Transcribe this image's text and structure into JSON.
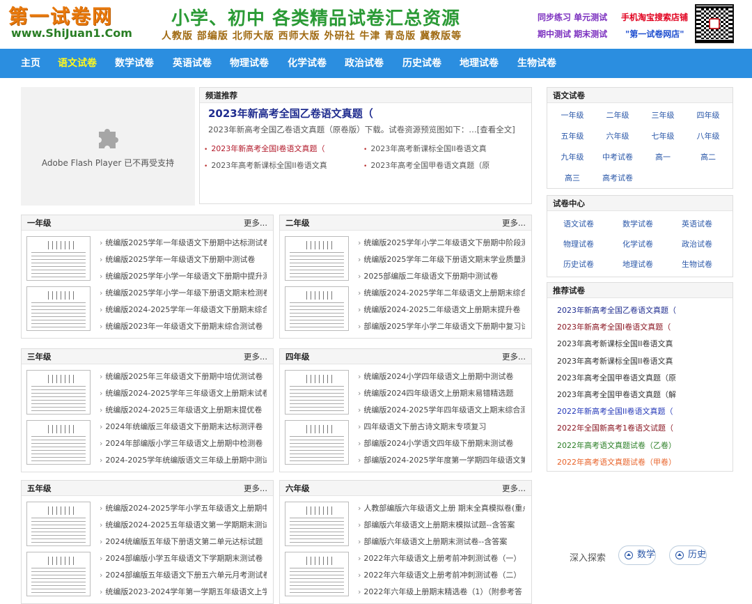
{
  "header": {
    "logo_text": "第一试卷网",
    "logo_url": "www.ShiJuan1.Com",
    "banner_title": "小学、初中 各类精品试卷汇总资源",
    "banner_publishers": "人教版 部编版 北师大版 西师大版 外研社 牛津 青岛版  冀教版等",
    "promo_1": "同步练习 单元测试",
    "promo_2": "期中测试 期末测试",
    "promo_3": "手机淘宝搜索店铺",
    "promo_4": "\"第一试卷网店\"",
    "qr_icon": "qr-code-icon"
  },
  "nav": {
    "items": [
      "主页",
      "语文试卷",
      "数学试卷",
      "英语试卷",
      "物理试卷",
      "化学试卷",
      "政治试卷",
      "历史试卷",
      "地理试卷",
      "生物试卷"
    ],
    "active_index": 1
  },
  "flash": {
    "icon": "puzzle-plugin-icon",
    "message": "Adobe Flash Player 已不再受支持"
  },
  "featured": {
    "header": "频道推荐",
    "title": "2023年新高考全国乙卷语文真题（",
    "desc": "2023年新高考全国乙卷语文真题（原卷版）下载。试卷资源预览图如下：…[查看全文]",
    "items": [
      "2023年新高考全国I卷语文真题（",
      "2023年高考新课标全国II卷语文真",
      "2023年高考新课标全国II卷语文真",
      "2023年高考全国甲卷语文真题（原"
    ]
  },
  "more_label": "更多...",
  "grades": [
    {
      "name": "一年级",
      "items": [
        "统编版2025学年一年级语文下册期中达标测试卷",
        "统编版2025学年一年级语文下册期中测试卷",
        "统编版2025学年小学一年级语文下册期中提升测",
        "统编版2025学年小学一年级下册语文期末检测卷",
        "统编版2024-2025学年一年级语文下册期末综合",
        "统编版2023年一年级语文下册期末综合测试卷"
      ]
    },
    {
      "name": "二年级",
      "items": [
        "统编版2025学年小学二年级语文下册期中阶段测",
        "统编版2025学年二年级下册语文期末学业质量测",
        "2025部编版二年级语文下册期中测试卷",
        "统编版2024-2025学年二年级语文上册期末综合",
        "统编版2024-2025二年级语文上册期末提升卷",
        "部编版2025学年小学二年级语文下册期中复习试"
      ]
    },
    {
      "name": "三年级",
      "items": [
        "统编版2025年三年级语文下册期中培优测试卷",
        "统编版2024-2025学年三年级语文上册期末试卷",
        "统编版2024-2025三年级语文上册期末提优卷",
        "2024年统编版三年级语文下册期末达标测评卷",
        "2024年部编版小学三年级语文上册期中检测卷",
        "2024-2025学年统编版语文三年级上册期中测试"
      ]
    },
    {
      "name": "四年级",
      "items": [
        "统编版2024小学四年级语文上册期中测试卷",
        "统编版2024四年级语文上册期末易错精选题",
        "统编版2024-2025学年四年级语文上期末综合测",
        "四年级语文下册古诗文期末专项复习",
        "部编版2024小学语文四年级下册期末测试卷",
        "部编版2024-2025学年度第一学期四年级语文第"
      ]
    },
    {
      "name": "五年级",
      "items": [
        "统编版2024-2025学年小学五年级语文上册期中",
        "统编版2024-2025五年级语文第一学期期末测试",
        "2024统编版五年级下册语文第二单元达标试题",
        "2024部编版小学五年级语文下学期期末测试卷",
        "2024部编版五年级语文下册五六单元月考测试卷",
        "统编版2023-2024学年第一学期五年级语文上学"
      ]
    },
    {
      "name": "六年级",
      "items": [
        "人教部编版六年级语文上册 期末全真模拟卷(重点",
        "部编版六年级语文上册期末模拟试题--含答案",
        "部编版六年级语文上册期末测试卷--含答案",
        "2022年六年级语文上册考前冲刺测试卷（一）",
        "2022年六年级语文上册考前冲刺测试卷（二）",
        "2022年六年级上册期末精选卷（1）（附参考答"
      ]
    }
  ],
  "sidebar_chinese": {
    "header": "语文试卷",
    "items": [
      "一年级",
      "二年级",
      "三年级",
      "四年级",
      "五年级",
      "六年级",
      "七年级",
      "八年级",
      "九年级",
      "中考试卷",
      "高一",
      "高二",
      "高三",
      "高考试卷"
    ]
  },
  "sidebar_center": {
    "header": "试卷中心",
    "items": [
      "语文试卷",
      "数学试卷",
      "英语试卷",
      "物理试卷",
      "化学试卷",
      "政治试卷",
      "历史试卷",
      "地理试卷",
      "生物试卷"
    ]
  },
  "sidebar_recommend": {
    "header": "推荐试卷",
    "items": [
      {
        "text": "2023年新高考全国乙卷语文真题（",
        "color": "#1f2c8f"
      },
      {
        "text": "2023年新高考全国I卷语文真题（",
        "color": "#8a1622"
      },
      {
        "text": "2023年高考新课标全国II卷语文真",
        "color": "#333333"
      },
      {
        "text": "2023年高考新课标全国II卷语文真",
        "color": "#333333"
      },
      {
        "text": "2023年高考全国甲卷语文真题（原",
        "color": "#333333"
      },
      {
        "text": "2023年高考全国甲卷语文真题（解",
        "color": "#333333"
      },
      {
        "text": "2022年新高考全国II卷语文真题（",
        "color": "#2438b8"
      },
      {
        "text": "2022年全国新高考1卷语文试题（",
        "color": "#8a1622"
      },
      {
        "text": "2022年高考语文真题试卷（乙卷）",
        "color": "#2a7e25"
      },
      {
        "text": "2022年高考语文真题试卷（甲卷）",
        "color": "#e8632a"
      }
    ]
  },
  "explore": {
    "label": "深入探索",
    "chips": [
      "数学",
      "历史"
    ],
    "chip_icon": "compass-icon"
  },
  "colors": {
    "nav_bg": "#2b8ee0",
    "nav_active": "#fff81e",
    "brand_orange": "#e8790d",
    "brand_green": "#2a9a35"
  }
}
